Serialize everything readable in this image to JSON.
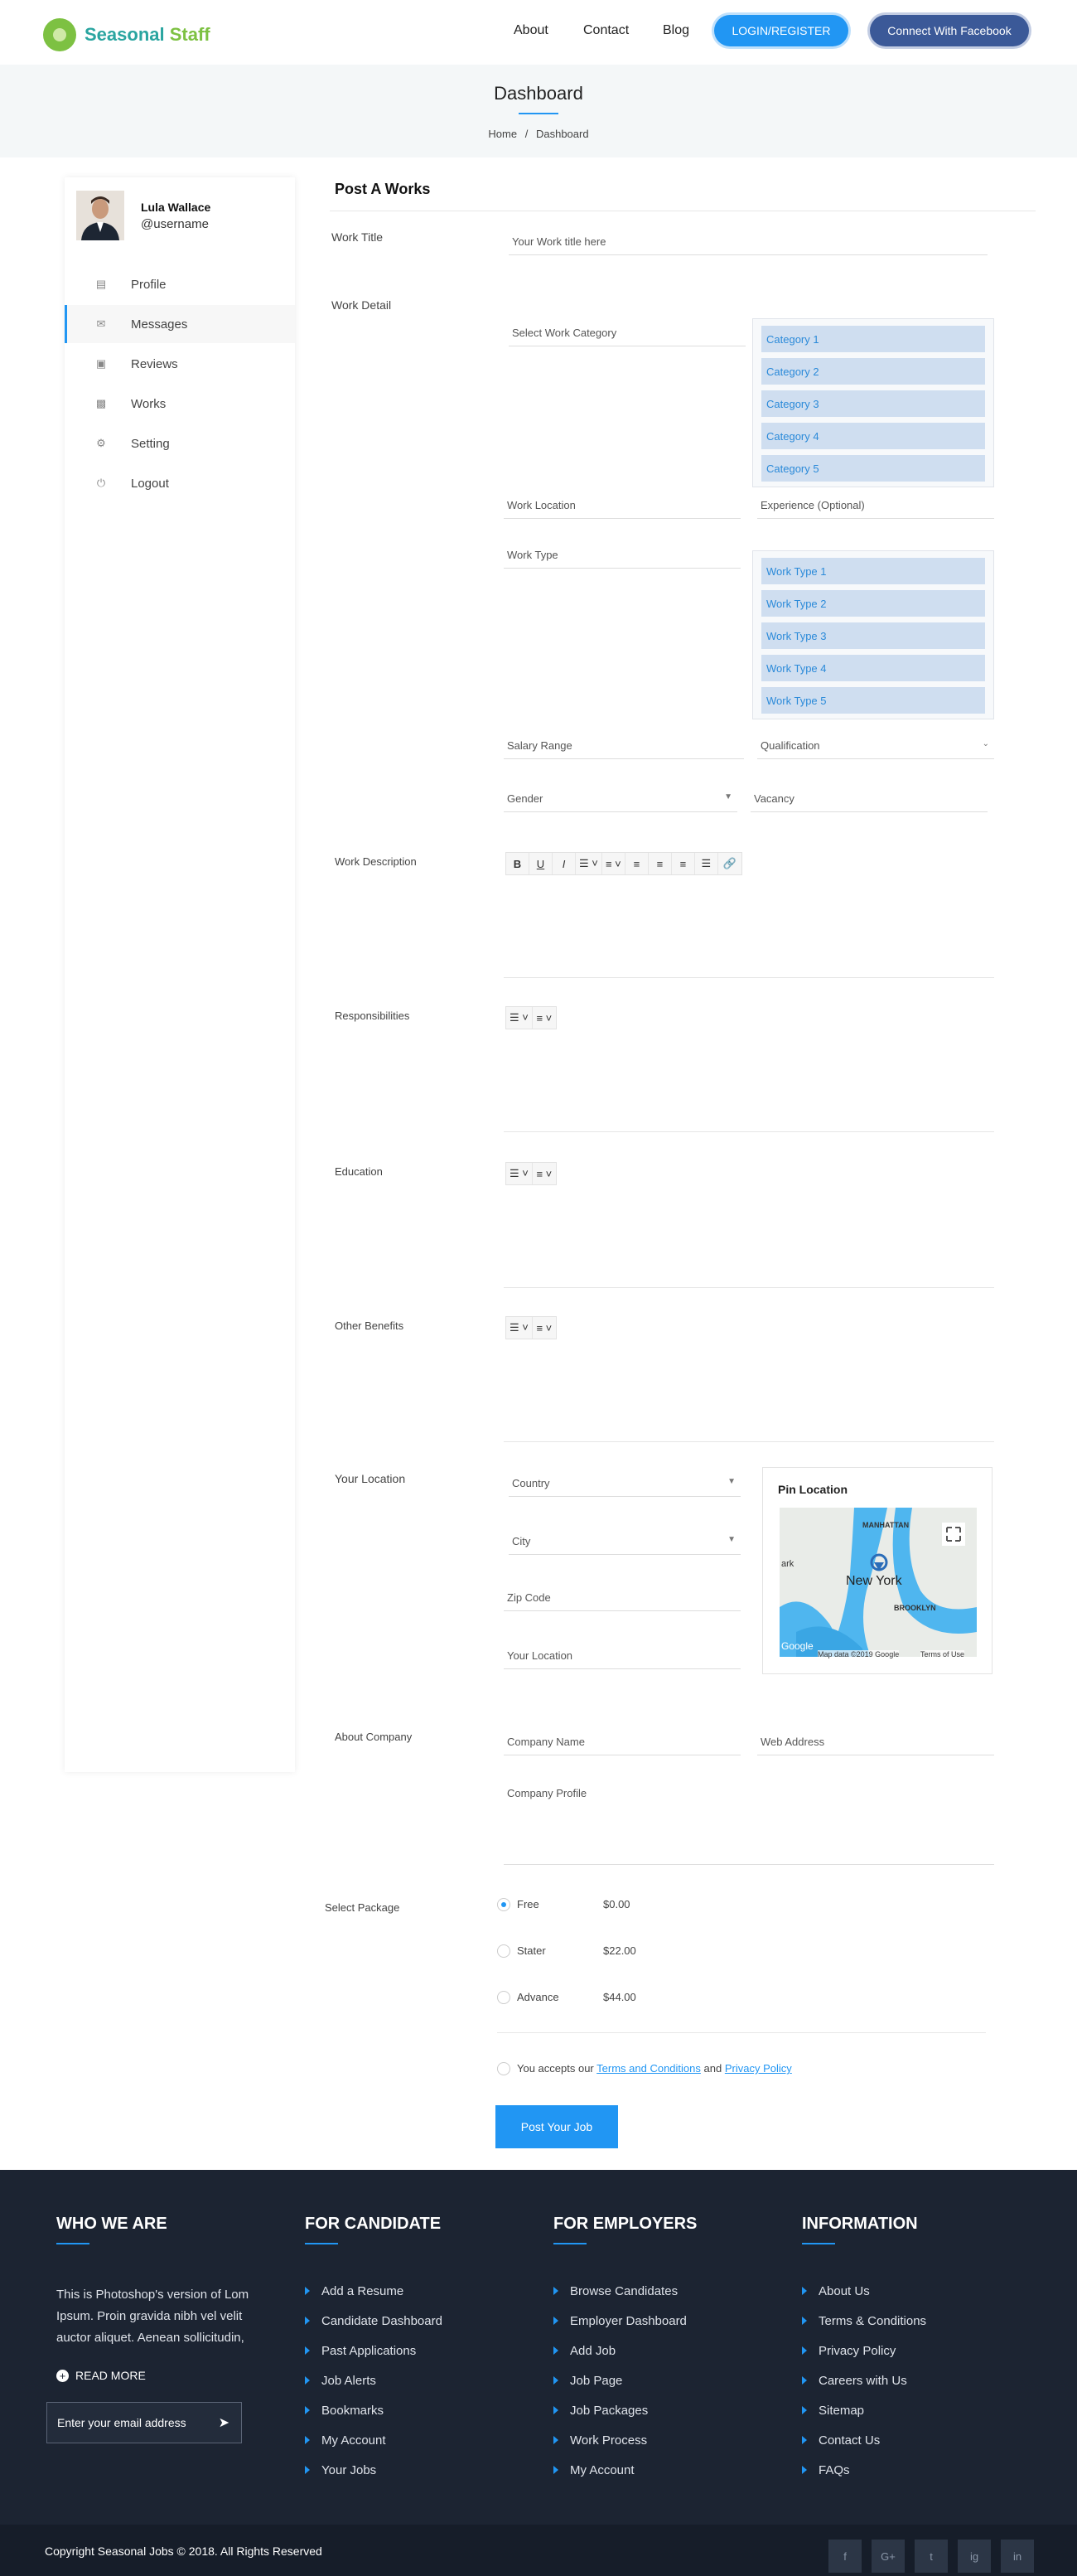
{
  "header": {
    "brand_first": "Seasonal",
    "brand_second": "Staff",
    "nav": [
      "About",
      "Contact",
      "Blog"
    ],
    "login_label": "LOGIN/REGISTER",
    "facebook_label": "Connect With Facebook"
  },
  "banner": {
    "title": "Dashboard",
    "breadcrumb_home": "Home",
    "breadcrumb_sep": "/",
    "breadcrumb_current": "Dashboard"
  },
  "sidebar": {
    "user_name": "Lula Wallace",
    "user_handle": "@username",
    "items": [
      {
        "label": "Profile",
        "icon": "profile-icon"
      },
      {
        "label": "Messages",
        "icon": "messages-icon",
        "active": true
      },
      {
        "label": "Reviews",
        "icon": "reviews-icon"
      },
      {
        "label": "Works",
        "icon": "works-icon"
      },
      {
        "label": "Setting",
        "icon": "gear-icon"
      },
      {
        "label": "Logout",
        "icon": "power-icon"
      }
    ]
  },
  "form": {
    "section_title": "Post A Works",
    "work_title_label": "Work Title",
    "work_title_placeholder": "Your Work title here",
    "work_detail_label": "Work Detail",
    "category_placeholder": "Select Work Category",
    "categories": [
      "Category 1",
      "Category 2",
      "Category 3",
      "Category 4",
      "Category 5"
    ],
    "work_location_placeholder": "Work Location",
    "experience_placeholder": "Experience (Optional)",
    "work_type_placeholder": "Work Type",
    "work_types": [
      "Work Type 1",
      "Work Type 2",
      "Work Type 3",
      "Work Type 4",
      "Work Type 5"
    ],
    "salary_placeholder": "Salary Range",
    "qualification_placeholder": "Qualification",
    "gender_placeholder": "Gender",
    "vacancy_placeholder": "Vacancy",
    "work_description_label": "Work Description",
    "responsibilities_label": "Responsibilities",
    "education_label": "Education",
    "other_benefits_label": "Other Benefits",
    "your_location_label": "Your Location",
    "country_placeholder": "Country",
    "city_placeholder": "City",
    "zip_placeholder": "Zip Code",
    "location_placeholder": "Your Location",
    "pin_location_title": "Pin Location",
    "map_labels": {
      "city": "New York",
      "manhattan": "MANHATTAN",
      "brooklyn": "BROOKLYN",
      "park": "ark",
      "google": "Google",
      "attribution": "Map data ©2019 Google",
      "terms": "Terms of Use"
    },
    "about_company_label": "About Company",
    "company_name_placeholder": "Company Name",
    "web_address_placeholder": "Web Address",
    "company_profile_placeholder": "Company Profile",
    "select_package_label": "Select Package",
    "packages": [
      {
        "name": "Free",
        "price": "$0.00",
        "selected": true
      },
      {
        "name": "Stater",
        "price": "$22.00",
        "selected": false
      },
      {
        "name": "Advance",
        "price": "$44.00",
        "selected": false
      }
    ],
    "terms_prefix": "You accepts our",
    "terms_link": "Terms and Conditions",
    "terms_and": "and",
    "privacy_link": "Privacy Policy",
    "submit_label": "Post Your Job"
  },
  "footer": {
    "who_title": "WHO WE ARE",
    "who_text": "This is Photoshop's version of Lom Ipsum. Proin gravida nibh vel velit auctor aliquet. Aenean sollicitudin,",
    "read_more": "READ MORE",
    "email_placeholder": "Enter your email address",
    "candidate_title": "FOR CANDIDATE",
    "candidate_links": [
      "Add a Resume",
      "Candidate Dashboard",
      "Past Applications",
      "Job Alerts",
      "Bookmarks",
      "My Account",
      "Your Jobs"
    ],
    "employer_title": "FOR EMPLOYERS",
    "employer_links": [
      "Browse Candidates",
      "Employer Dashboard",
      "Add Job",
      "Job Page",
      "Job Packages",
      "Work Process",
      "My Account"
    ],
    "info_title": "INFORMATION",
    "info_links": [
      "About Us",
      "Terms & Conditions",
      "Privacy Policy",
      "Careers with Us",
      "Sitemap",
      "Contact Us",
      "FAQs"
    ],
    "copyright": "Copyright Seasonal Jobs © 2018. All Rights Reserved",
    "social": [
      "f",
      "G+",
      "t",
      "ig",
      "in"
    ]
  },
  "colors": {
    "accent": "#2196f3",
    "brand_green": "#7dc142",
    "footer_bg": "#1c2432",
    "facebook": "#3b5998"
  }
}
